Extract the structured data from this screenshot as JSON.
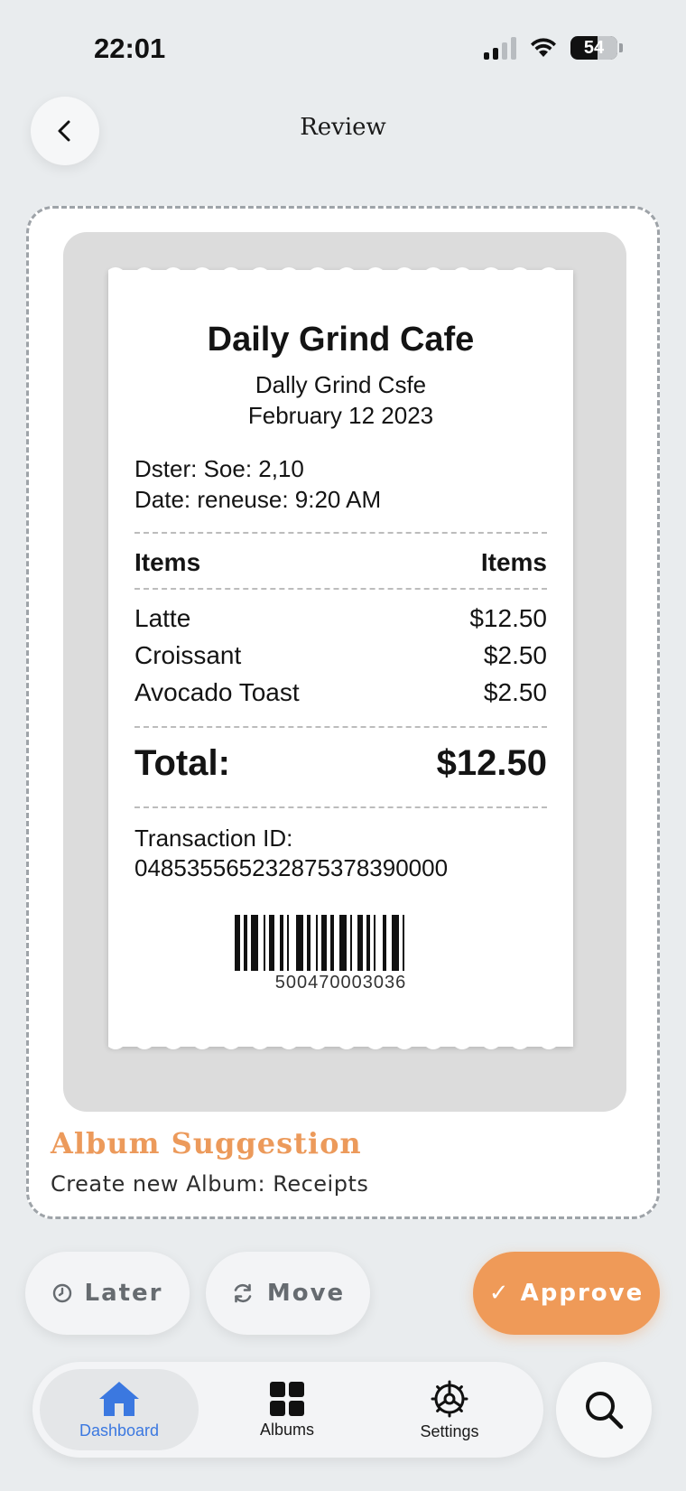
{
  "status": {
    "time": "22:01",
    "battery": "54"
  },
  "header": {
    "title": "Review",
    "back_icon": "chevron-left-icon"
  },
  "receipt": {
    "store": "Daily Grind Cafe",
    "subtitle": "Dally Grind Csfe",
    "date": "February 12 2023",
    "meta1": "Dster: Soe: 2,10",
    "meta2": "Date: reneuse: 9:20 AM",
    "header_left": "Items",
    "header_right": "Items",
    "items": [
      {
        "name": "Latte",
        "price": "$12.50"
      },
      {
        "name": "Croissant",
        "price": "$2.50"
      },
      {
        "name": "Avocado Toast",
        "price": "$2.50"
      }
    ],
    "total_label": "Total:",
    "total_value": "$12.50",
    "txn_label": "Transaction ID:",
    "txn_id": "048535565232875378390000",
    "barcode_number": "500470003036"
  },
  "suggestion": {
    "title": "Album Suggestion",
    "text": "Create new Album: Receipts",
    "accent_color": "#ec9a5b"
  },
  "actions": {
    "later": "Later",
    "move": "Move",
    "approve": "✓ Approve",
    "approve_color": "#ef9a58"
  },
  "nav": {
    "items": [
      {
        "label": "Dashboard",
        "icon": "home-icon",
        "active": true
      },
      {
        "label": "Albums",
        "icon": "grid-icon",
        "active": false
      },
      {
        "label": "Settings",
        "icon": "gear-icon",
        "active": false
      }
    ],
    "search_icon": "search-icon",
    "active_color": "#3b78e0"
  }
}
